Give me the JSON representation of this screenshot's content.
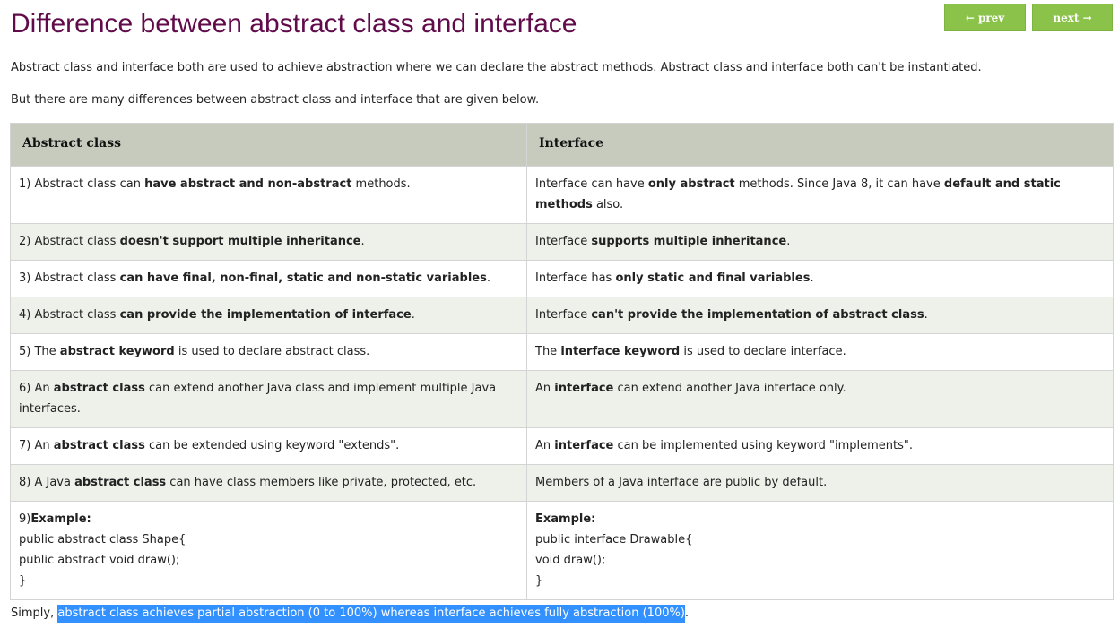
{
  "header": {
    "title": "Difference between abstract class and interface",
    "prev_label": "← prev",
    "next_label": "next →"
  },
  "intro": {
    "p1": "Abstract class and interface both are used to achieve abstraction where we can declare the abstract methods. Abstract class and interface both can't be instantiated.",
    "p2": "But there are many differences between abstract class and interface that are given below."
  },
  "table": {
    "headers": [
      "Abstract class",
      "Interface"
    ],
    "rows": [
      {
        "left": [
          {
            "t": "1) Abstract class can "
          },
          {
            "t": "have abstract and non-abstract",
            "b": true
          },
          {
            "t": " methods."
          }
        ],
        "right": [
          {
            "t": "Interface can have "
          },
          {
            "t": "only abstract",
            "b": true
          },
          {
            "t": " methods. Since Java 8, it can have "
          },
          {
            "t": "default and static methods",
            "b": true
          },
          {
            "t": " also."
          }
        ]
      },
      {
        "left": [
          {
            "t": "2) Abstract class "
          },
          {
            "t": "doesn't support multiple inheritance",
            "b": true
          },
          {
            "t": "."
          }
        ],
        "right": [
          {
            "t": "Interface "
          },
          {
            "t": "supports multiple inheritance",
            "b": true
          },
          {
            "t": "."
          }
        ]
      },
      {
        "left": [
          {
            "t": "3) Abstract class "
          },
          {
            "t": "can have final, non-final, static and non-static variables",
            "b": true
          },
          {
            "t": "."
          }
        ],
        "right": [
          {
            "t": "Interface has "
          },
          {
            "t": "only static and final variables",
            "b": true
          },
          {
            "t": "."
          }
        ]
      },
      {
        "left": [
          {
            "t": "4) Abstract class "
          },
          {
            "t": "can provide the implementation of interface",
            "b": true
          },
          {
            "t": "."
          }
        ],
        "right": [
          {
            "t": "Interface "
          },
          {
            "t": "can't provide the implementation of abstract class",
            "b": true
          },
          {
            "t": "."
          }
        ]
      },
      {
        "left": [
          {
            "t": "5) The "
          },
          {
            "t": "abstract keyword",
            "b": true
          },
          {
            "t": " is used to declare abstract class."
          }
        ],
        "right": [
          {
            "t": "The "
          },
          {
            "t": "interface keyword",
            "b": true
          },
          {
            "t": " is used to declare interface."
          }
        ]
      },
      {
        "left": [
          {
            "t": "6) An "
          },
          {
            "t": "abstract class",
            "b": true
          },
          {
            "t": " can extend another Java class and implement multiple Java interfaces."
          }
        ],
        "right": [
          {
            "t": "An "
          },
          {
            "t": "interface",
            "b": true
          },
          {
            "t": " can extend another Java interface only."
          }
        ]
      },
      {
        "left": [
          {
            "t": "7) An "
          },
          {
            "t": "abstract class",
            "b": true
          },
          {
            "t": " can be extended using keyword \"extends\"."
          }
        ],
        "right": [
          {
            "t": "An "
          },
          {
            "t": "interface",
            "b": true
          },
          {
            "t": " can be implemented using keyword \"implements\"."
          }
        ]
      },
      {
        "left": [
          {
            "t": "8) A Java "
          },
          {
            "t": "abstract class",
            "b": true
          },
          {
            "t": " can have class members like private, protected, etc."
          }
        ],
        "right": [
          {
            "t": "Members of a Java interface are public by default."
          }
        ]
      }
    ],
    "example": {
      "left_prefix": "9)",
      "left_heading": "Example:",
      "left_code": [
        "public abstract class Shape{",
        "public abstract void draw();",
        "}"
      ],
      "right_heading": "Example:",
      "right_code": [
        "public interface Drawable{",
        "void draw();",
        "}"
      ]
    }
  },
  "summary": {
    "prefix": "Simply, ",
    "selected": "abstract class achieves partial abstraction (0 to 100%) whereas interface achieves fully abstraction (100%)",
    "suffix": "."
  },
  "colors": {
    "title": "#610b4b",
    "nav_button": "#8bc34a",
    "table_header": "#c7cbbd",
    "row_even": "#eef0ea",
    "selection": "#3390ff"
  }
}
